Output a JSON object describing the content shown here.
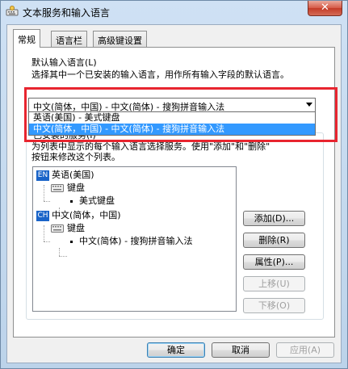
{
  "window": {
    "title": "文本服务和输入语言",
    "close_label": "✕"
  },
  "tabs": [
    {
      "label": "常规",
      "selected": true
    },
    {
      "label": "语言栏",
      "selected": false
    },
    {
      "label": "高级键设置",
      "selected": false
    }
  ],
  "default_lang": {
    "heading": "默认输入语言(L)",
    "description": "选择其中一个已安装的输入语言，用作所有输入字段的默认语言。",
    "selected_value": "中文(简体，中国) - 中文(简体) - 搜狗拼音输入法",
    "dropdown_options": [
      "英语(美国) - 美式键盘",
      "中文(简体，中国) - 中文(简体) - 搜狗拼音输入法"
    ]
  },
  "services": {
    "group_title": "已安装的服务(I)",
    "description_line1": "为列表中显示的每个输入语言选择服务。使用\"添加\"和\"删除\"",
    "description_line2": "按钮来修改这个列表。",
    "tree": {
      "lang1_badge": "EN",
      "lang1_label": "英语(美国)",
      "lang1_keyboard": "键盘",
      "lang1_layout": "美式键盘",
      "lang2_badge": "CH",
      "lang2_label": "中文(简体，中国)",
      "lang2_keyboard": "键盘",
      "lang2_layout": "中文(简体) - 搜狗拼音输入法"
    },
    "buttons": {
      "add": "添加(D)...",
      "remove": "删除(R)",
      "properties": "属性(P)...",
      "move_up": "上移(U)",
      "move_down": "下移(O)"
    }
  },
  "footer": {
    "ok": "确定",
    "cancel": "取消",
    "apply": "应用(A)"
  },
  "colors": {
    "selection": "#3399ff",
    "highlight_frame": "#e8252f",
    "language_badge": "#1a64c8"
  }
}
